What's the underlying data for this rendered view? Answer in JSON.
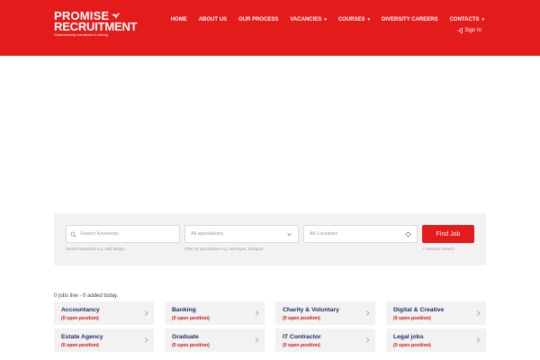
{
  "brand": {
    "name_line1": "PROMISE",
    "name_line2": "RECRUITMENT",
    "tagline": "Global diversity recruitment & training",
    "color": "#e31b1b"
  },
  "nav": {
    "items": [
      {
        "label": "HOME",
        "caret": false
      },
      {
        "label": "ABOUT US",
        "caret": false
      },
      {
        "label": "OUR PROCESS",
        "caret": false
      },
      {
        "label": "VACANCIES",
        "caret": true
      },
      {
        "label": "COURSES",
        "caret": true
      },
      {
        "label": "DIVERSITY CAREERS",
        "caret": false
      },
      {
        "label": "CONTACTS",
        "caret": true
      }
    ],
    "signin_label": "Sign In",
    "signin_icon": "sign-in-icon"
  },
  "search": {
    "keywords_placeholder": "Search Keywords",
    "keywords_value": "",
    "keywords_hint": "Search keywords e.g. web design",
    "specialisms_placeholder": "All specialisms",
    "specialisms_hint": "Filter by specialisms e.g. developer, designer",
    "locations_placeholder": "All Locations",
    "locations_value": "",
    "find_label": "Find Job",
    "advanced_label": "+ Advance Search"
  },
  "jobs_summary": "0 jobs live - 0 added today.",
  "categories": [
    {
      "title": "Accountancy",
      "count": "(0 open position)"
    },
    {
      "title": "Banking",
      "count": "(0 open position)"
    },
    {
      "title": "Charity & Voluntary",
      "count": "(0 open position)"
    },
    {
      "title": "Digital & Creative",
      "count": "(0 open position)"
    },
    {
      "title": "Estate Agency",
      "count": "(0 open position)"
    },
    {
      "title": "Graduate",
      "count": "(0 open position)"
    },
    {
      "title": "IT Contractor",
      "count": "(0 open position)"
    },
    {
      "title": "Legal jobs",
      "count": "(0 open position)"
    }
  ]
}
